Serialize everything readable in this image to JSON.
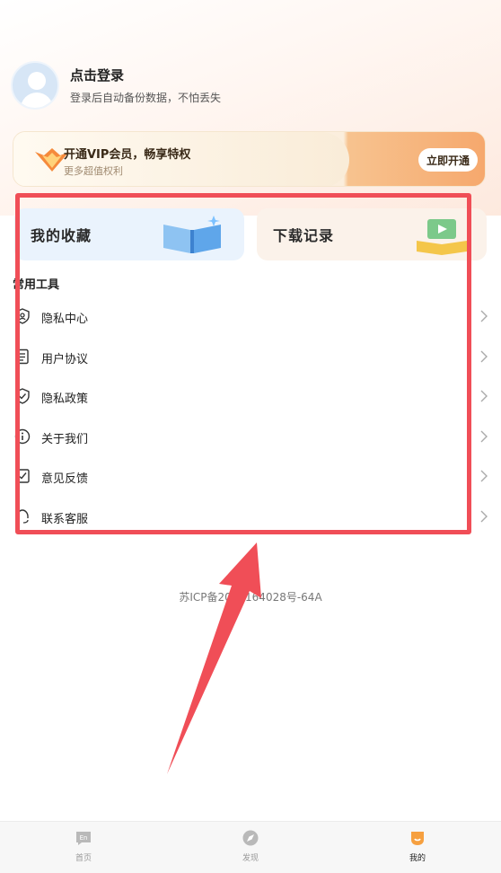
{
  "profile": {
    "title": "点击登录",
    "subtitle": "登录后自动备份数据，不怕丢失"
  },
  "vip": {
    "title": "开通VIP会员，畅享特权",
    "subtitle": "更多超值权利",
    "button": "立即开通"
  },
  "quick": {
    "favorites": "我的收藏",
    "downloads": "下载记录"
  },
  "tools": {
    "title": "常用工具",
    "items": [
      {
        "label": "隐私中心",
        "icon": "privacy-center-icon"
      },
      {
        "label": "用户协议",
        "icon": "document-icon"
      },
      {
        "label": "隐私政策",
        "icon": "shield-check-icon"
      },
      {
        "label": "关于我们",
        "icon": "info-icon"
      },
      {
        "label": "意见反馈",
        "icon": "feedback-icon"
      },
      {
        "label": "联系客服",
        "icon": "headset-icon"
      }
    ]
  },
  "footer": {
    "icp": "苏ICP备2025164028号-64A"
  },
  "tabbar": {
    "items": [
      {
        "label": "首页",
        "icon": "home-en-icon",
        "active": false
      },
      {
        "label": "发现",
        "icon": "discover-icon",
        "active": false
      },
      {
        "label": "我的",
        "icon": "profile-tab-icon",
        "active": true
      }
    ]
  },
  "colors": {
    "highlight": "#f04e57",
    "accent": "#f6a86d"
  }
}
